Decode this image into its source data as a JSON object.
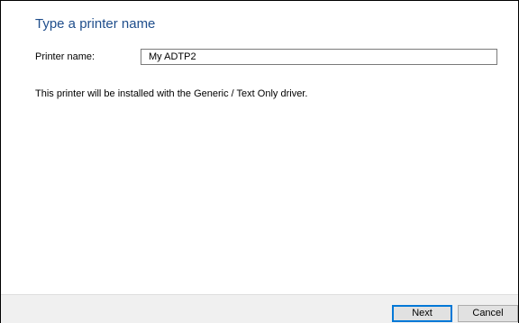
{
  "dialog": {
    "heading": "Type a printer name",
    "printer_name_label": "Printer name:",
    "printer_name_value": "My ADTP2",
    "info_text": "This printer will be installed with the Generic / Text Only driver."
  },
  "footer": {
    "next_label": "Next",
    "cancel_label": "Cancel"
  },
  "colors": {
    "heading": "#1f4e8c",
    "footer_background": "#f0f0f0",
    "default_button_border": "#0078d7"
  }
}
